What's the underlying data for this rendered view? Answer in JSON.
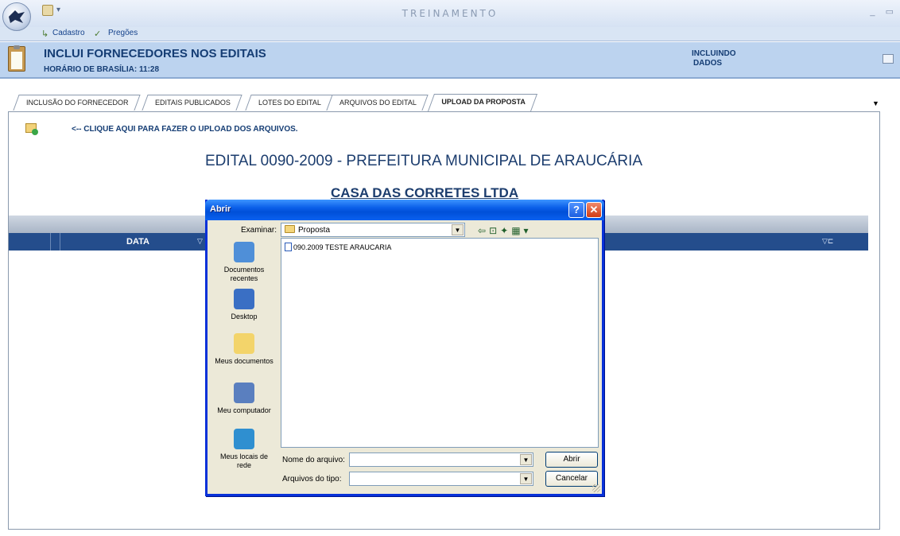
{
  "app": {
    "title": "TREINAMENTO",
    "window_controls": [
      "_",
      "▭"
    ]
  },
  "menu": {
    "items": [
      "Cadastro",
      "Pregões"
    ]
  },
  "header": {
    "title": "INCLUI FORNECEDORES NOS EDITAIS",
    "subtitle": "HORÁRIO DE BRASÍLIA: 11:28",
    "status_line1": "INCLUINDO",
    "status_line2": "DADOS"
  },
  "tabs": [
    {
      "label": "INCLUSÃO DO FORNECEDOR",
      "active": false
    },
    {
      "label": "EDITAIS PUBLICADOS",
      "active": false
    },
    {
      "label": "LOTES DO EDITAL",
      "active": false
    },
    {
      "label": "ARQUIVOS DO EDITAL",
      "active": false
    },
    {
      "label": "UPLOAD DA PROPOSTA",
      "active": true
    }
  ],
  "main": {
    "upload_link": "<-- CLIQUE AQUI PARA FAZER O UPLOAD DOS ARQUIVOS.",
    "edital_title": "EDITAL 0090-2009 - PREFEITURA MUNICIPAL DE ARAUCÁRIA",
    "company": "CASA DAS CORRETES LTDA"
  },
  "grid": {
    "columns": [
      "DATA"
    ]
  },
  "dialog": {
    "title": "Abrir",
    "help": "?",
    "close": "✕",
    "lookin_label": "Examinar:",
    "lookin_value": "Proposta",
    "places": [
      {
        "label": "Documentos recentes",
        "color": "#4f8fd8"
      },
      {
        "label": "Desktop",
        "color": "#3a6fc4"
      },
      {
        "label": "Meus documentos",
        "color": "#f3d46a"
      },
      {
        "label": "Meu computador",
        "color": "#5a7fbf"
      },
      {
        "label": "Meus locais de rede",
        "color": "#2f8fd0"
      }
    ],
    "files": [
      "090.2009 TESTE ARAUCARIA"
    ],
    "filename_label": "Nome do arquivo:",
    "filename_value": "",
    "filetype_label": "Arquivos do tipo:",
    "filetype_value": "",
    "open_button": "Abrir",
    "cancel_button": "Cancelar"
  }
}
